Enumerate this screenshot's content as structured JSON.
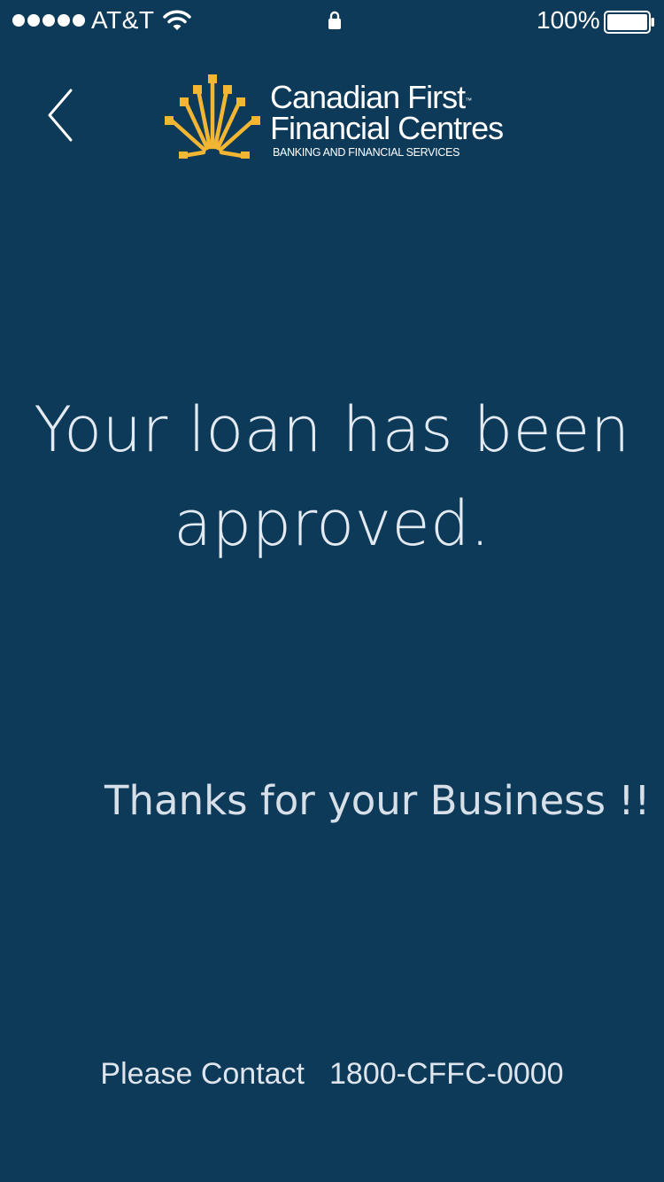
{
  "status_bar": {
    "carrier": "AT&T",
    "signal_bars": 5,
    "battery_percent": "100%",
    "icons": [
      "signal-dots-icon",
      "wifi-icon",
      "lock-icon",
      "battery-icon"
    ]
  },
  "header": {
    "back_icon": "chevron-left-icon",
    "logo": {
      "line1": "Canadian First",
      "trademark": "™",
      "line2": "Financial Centres",
      "tagline": "BANKING AND FINANCIAL SERVICES",
      "mark_icon": "starburst-logo-icon"
    }
  },
  "main": {
    "headline_line1": "Your loan has been",
    "headline_line2": "approved.",
    "thanks": "Thanks for your Business !!",
    "contact_label": "Please Contact",
    "contact_phone": "1800-CFFC-0000"
  },
  "colors": {
    "background": "#0e3a5a",
    "text": "#ffffff",
    "logo_accent": "#f2b632"
  }
}
